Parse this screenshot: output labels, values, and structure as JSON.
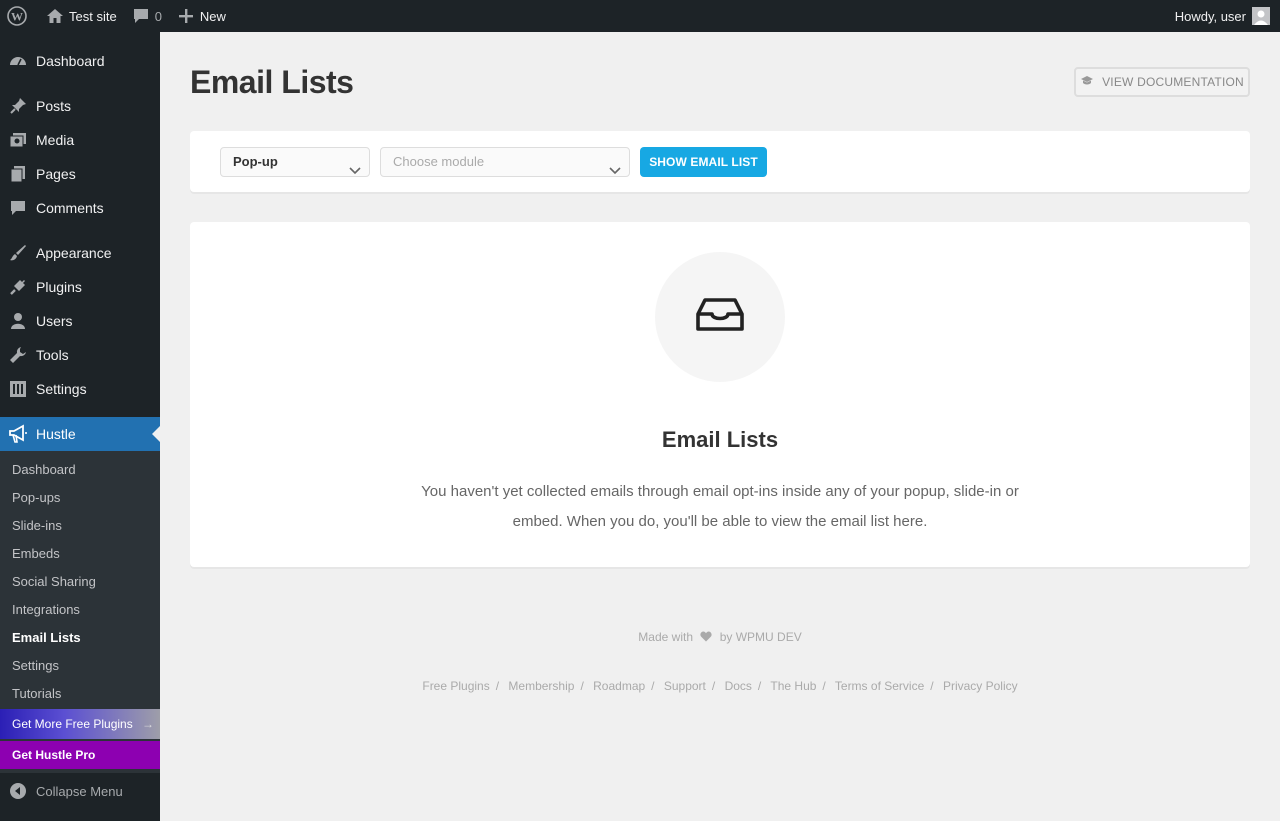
{
  "adminbar": {
    "site_name": "Test site",
    "comments_count": "0",
    "new_label": "New",
    "howdy": "Howdy, user"
  },
  "sidebar": {
    "items": [
      {
        "label": "Dashboard",
        "icon": "dashboard-icon"
      },
      {
        "label": "Posts",
        "icon": "pin-icon"
      },
      {
        "label": "Media",
        "icon": "media-icon"
      },
      {
        "label": "Pages",
        "icon": "pages-icon"
      },
      {
        "label": "Comments",
        "icon": "comment-icon"
      },
      {
        "label": "Appearance",
        "icon": "brush-icon"
      },
      {
        "label": "Plugins",
        "icon": "plug-icon"
      },
      {
        "label": "Users",
        "icon": "user-icon"
      },
      {
        "label": "Tools",
        "icon": "wrench-icon"
      },
      {
        "label": "Settings",
        "icon": "settings-icon"
      },
      {
        "label": "Hustle",
        "icon": "megaphone-icon"
      }
    ],
    "submenu": [
      "Dashboard",
      "Pop-ups",
      "Slide-ins",
      "Embeds",
      "Social Sharing",
      "Integrations",
      "Email Lists",
      "Settings",
      "Tutorials"
    ],
    "current_submenu": "Email Lists",
    "promo_free": "Get More Free Plugins",
    "promo_pro": "Get Hustle Pro",
    "collapse": "Collapse Menu"
  },
  "main": {
    "title": "Email Lists",
    "doc_button": "VIEW DOCUMENTATION",
    "filter": {
      "type_value": "Pop-up",
      "module_placeholder": "Choose module",
      "show_button": "SHOW EMAIL LIST"
    },
    "empty": {
      "title": "Email Lists",
      "text": "You haven't yet collected emails through email opt-ins inside any of your popup, slide-in or embed. When you do, you'll be able to view the email list here."
    }
  },
  "footer": {
    "made_with": "Made with",
    "by": "by WPMU DEV",
    "links": [
      "Free Plugins",
      "Membership",
      "Roadmap",
      "Support",
      "Docs",
      "The Hub",
      "Terms of Service",
      "Privacy Policy"
    ]
  },
  "colors": {
    "admin_dark": "#1d2327",
    "active_blue": "#2271b1",
    "show_button": "#17a8e3",
    "promo_pro": "#8d00b1"
  }
}
